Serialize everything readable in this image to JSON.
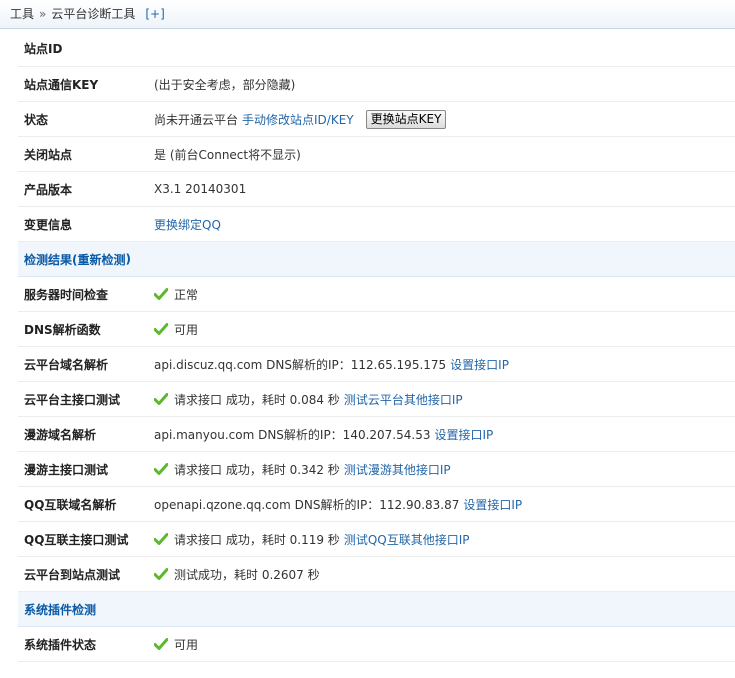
{
  "breadcrumb": {
    "root": "工具",
    "separator": "»",
    "current": "云平台诊断工具",
    "add": "[+]"
  },
  "info": {
    "site_id": {
      "label": "站点ID",
      "value": ""
    },
    "site_key": {
      "label": "站点通信KEY",
      "value": "(出于安全考虑，部分隐藏)"
    },
    "status": {
      "label": "状态",
      "text": "尚未开通云平台",
      "link": "手动修改站点ID/KEY",
      "button": "更换站点KEY"
    },
    "close_site": {
      "label": "关闭站点",
      "value": "是 (前台Connect将不显示)"
    },
    "version": {
      "label": "产品版本",
      "value": "X3.1 20140301"
    },
    "change": {
      "label": "变更信息",
      "link": "更换绑定QQ"
    }
  },
  "check_section": {
    "title": "检测结果(",
    "link": "重新检测",
    "close": ")"
  },
  "checks": {
    "server_time": {
      "label": "服务器时间检查",
      "value": "正常"
    },
    "dns_func": {
      "label": "DNS解析函数",
      "value": "可用"
    },
    "cloud_domain": {
      "label": "云平台域名解析",
      "text": "api.discuz.qq.com DNS解析的IP：112.65.195.175",
      "link": "设置接口IP"
    },
    "cloud_api": {
      "label": "云平台主接口测试",
      "text": "请求接口 成功，耗时 0.084 秒",
      "link": "测试云平台其他接口IP"
    },
    "manyou_domain": {
      "label": "漫游域名解析",
      "text": "api.manyou.com DNS解析的IP：140.207.54.53",
      "link": "设置接口IP"
    },
    "manyou_api": {
      "label": "漫游主接口测试",
      "text": "请求接口 成功，耗时 0.342 秒",
      "link": "测试漫游其他接口IP"
    },
    "qq_domain": {
      "label": "QQ互联域名解析",
      "text": "openapi.qzone.qq.com DNS解析的IP：112.90.83.87",
      "link": "设置接口IP"
    },
    "qq_api": {
      "label": "QQ互联主接口测试",
      "text": "请求接口 成功，耗时 0.119 秒",
      "link": "测试QQ互联其他接口IP"
    },
    "cloud_to_site": {
      "label": "云平台到站点测试",
      "text": "测试成功，耗时 0.2607 秒"
    }
  },
  "plugin_section": {
    "title": "系统插件检测"
  },
  "plugin": {
    "status": {
      "label": "系统插件状态",
      "value": "可用"
    }
  },
  "colors": {
    "link": "#2366a8",
    "section_bg": "#f1f6fc",
    "section_text": "#0b5aa6",
    "check": "#5cb82e"
  }
}
